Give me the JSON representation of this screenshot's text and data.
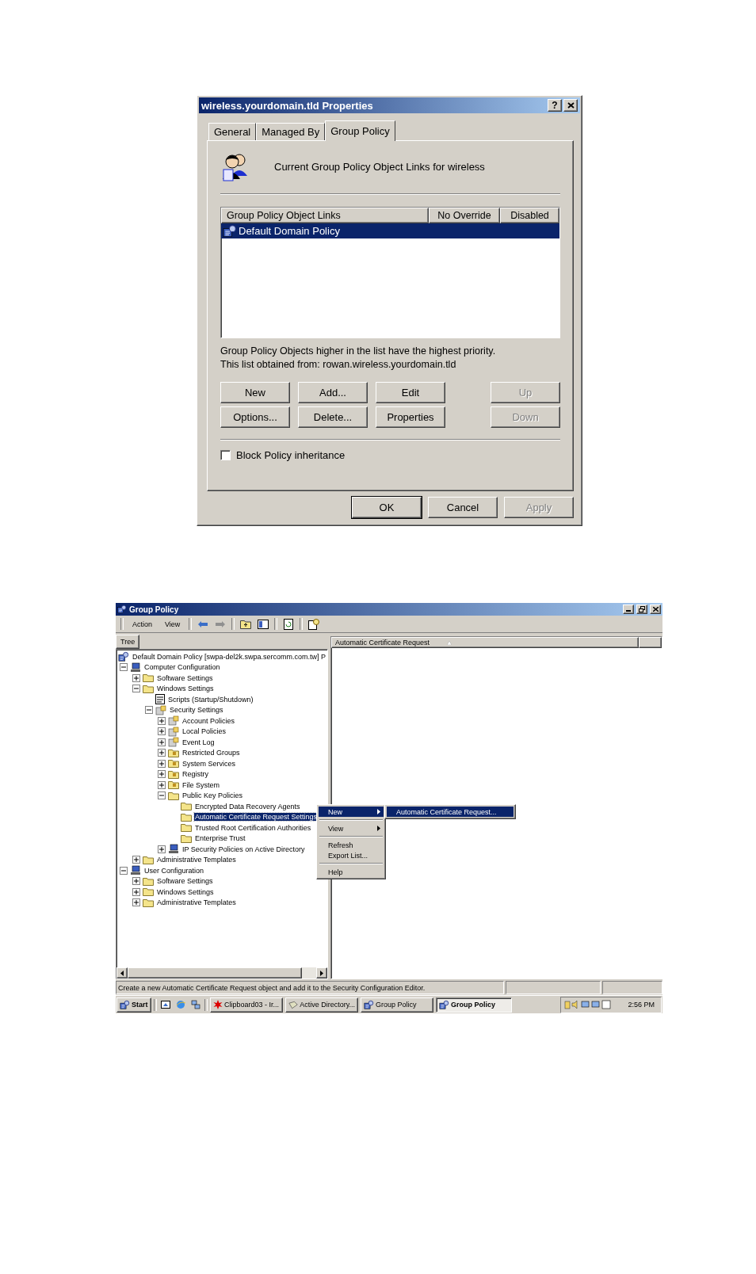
{
  "properties_dialog": {
    "title": "wireless.yourdomain.tld Properties",
    "help_button": "?",
    "tabs": [
      {
        "label": "General",
        "selected": false
      },
      {
        "label": "Managed By",
        "selected": false
      },
      {
        "label": "Group Policy",
        "selected": true
      }
    ],
    "header_text": "Current Group Policy Object Links for wireless",
    "list": {
      "columns": [
        "Group Policy Object Links",
        "No Override",
        "Disabled"
      ],
      "rows": [
        {
          "name": "Default Domain Policy",
          "selected": true
        }
      ]
    },
    "info_lines": [
      "Group Policy Objects higher in the list have the highest priority.",
      "This list obtained from: rowan.wireless.yourdomain.tld"
    ],
    "buttons": [
      {
        "label": "New",
        "disabled": false
      },
      {
        "label": "Add...",
        "disabled": false
      },
      {
        "label": "Edit",
        "disabled": false
      },
      {
        "label": "Up",
        "disabled": true
      },
      {
        "label": "Options...",
        "disabled": false
      },
      {
        "label": "Delete...",
        "disabled": false
      },
      {
        "label": "Properties",
        "disabled": false
      },
      {
        "label": "Down",
        "disabled": true
      }
    ],
    "block_inheritance": {
      "label": "Block Policy inheritance",
      "checked": false
    },
    "footer_buttons": [
      {
        "label": "OK",
        "disabled": false,
        "default": true
      },
      {
        "label": "Cancel",
        "disabled": false,
        "default": false
      },
      {
        "label": "Apply",
        "disabled": true,
        "default": false
      }
    ]
  },
  "group_policy_window": {
    "title": "Group Policy",
    "menu": [
      "Action",
      "View"
    ],
    "tree_tab": "Tree",
    "list_column": "Automatic Certificate Request",
    "tree": [
      {
        "label": "Default Domain Policy [swpa-del2k.swpa.sercomm.com.tw] P",
        "kind": "policy",
        "has_toggle": false,
        "selected": false,
        "children": [
          {
            "label": "Computer Configuration",
            "kind": "computer",
            "has_toggle": true,
            "expanded": true,
            "selected": false,
            "children": [
              {
                "label": "Software Settings",
                "kind": "folder",
                "has_toggle": true,
                "expanded": false,
                "selected": false
              },
              {
                "label": "Windows Settings",
                "kind": "folder",
                "has_toggle": true,
                "expanded": true,
                "selected": false,
                "children": [
                  {
                    "label": "Scripts (Startup/Shutdown)",
                    "kind": "scripts",
                    "has_toggle": false,
                    "selected": false
                  },
                  {
                    "label": "Security Settings",
                    "kind": "security",
                    "has_toggle": true,
                    "expanded": true,
                    "selected": false,
                    "children": [
                      {
                        "label": "Account Policies",
                        "kind": "security",
                        "has_toggle": true,
                        "expanded": false,
                        "selected": false
                      },
                      {
                        "label": "Local Policies",
                        "kind": "security",
                        "has_toggle": true,
                        "expanded": false,
                        "selected": false
                      },
                      {
                        "label": "Event Log",
                        "kind": "security",
                        "has_toggle": true,
                        "expanded": false,
                        "selected": false
                      },
                      {
                        "label": "Restricted Groups",
                        "kind": "lockfolder",
                        "has_toggle": true,
                        "expanded": false,
                        "selected": false
                      },
                      {
                        "label": "System Services",
                        "kind": "lockfolder",
                        "has_toggle": true,
                        "expanded": false,
                        "selected": false
                      },
                      {
                        "label": "Registry",
                        "kind": "lockfolder",
                        "has_toggle": true,
                        "expanded": false,
                        "selected": false
                      },
                      {
                        "label": "File System",
                        "kind": "lockfolder",
                        "has_toggle": true,
                        "expanded": false,
                        "selected": false
                      },
                      {
                        "label": "Public Key Policies",
                        "kind": "folder",
                        "has_toggle": true,
                        "expanded": true,
                        "selected": false,
                        "children": [
                          {
                            "label": "Encrypted Data Recovery Agents",
                            "kind": "folder",
                            "has_toggle": false,
                            "selected": false
                          },
                          {
                            "label": "Automatic Certificate Request Settings",
                            "kind": "folder",
                            "has_toggle": false,
                            "selected": true
                          },
                          {
                            "label": "Trusted Root Certification Authorities",
                            "kind": "folder",
                            "has_toggle": false,
                            "selected": false
                          },
                          {
                            "label": "Enterprise Trust",
                            "kind": "folder",
                            "has_toggle": false,
                            "selected": false
                          }
                        ]
                      },
                      {
                        "label": "IP Security Policies on Active Directory",
                        "kind": "computer",
                        "has_toggle": true,
                        "expanded": false,
                        "selected": false
                      }
                    ]
                  }
                ]
              },
              {
                "label": "Administrative Templates",
                "kind": "folder",
                "has_toggle": true,
                "expanded": false,
                "selected": false
              }
            ]
          },
          {
            "label": "User Configuration",
            "kind": "computer",
            "has_toggle": true,
            "expanded": true,
            "selected": false,
            "children": [
              {
                "label": "Software Settings",
                "kind": "folder",
                "has_toggle": true,
                "expanded": false,
                "selected": false
              },
              {
                "label": "Windows Settings",
                "kind": "folder",
                "has_toggle": true,
                "expanded": false,
                "selected": false
              },
              {
                "label": "Administrative Templates",
                "kind": "folder",
                "has_toggle": true,
                "expanded": false,
                "selected": false
              }
            ]
          }
        ]
      }
    ],
    "context_menu": {
      "groups": [
        {
          "items": [
            {
              "label": "New",
              "submenu": true,
              "selected": true
            }
          ]
        },
        {
          "items": [
            {
              "label": "View",
              "submenu": true,
              "selected": false
            }
          ]
        },
        {
          "items": [
            {
              "label": "Refresh",
              "submenu": false,
              "selected": false
            },
            {
              "label": "Export List...",
              "submenu": false,
              "selected": false
            }
          ]
        },
        {
          "items": [
            {
              "label": "Help",
              "submenu": false,
              "selected": false
            }
          ]
        }
      ]
    },
    "submenu": [
      {
        "label": "Automatic Certificate Request...",
        "selected": true
      }
    ],
    "status_text": "Create a new Automatic Certificate Request object and add it to the Security Configuration Editor.",
    "taskbar": {
      "start": "Start",
      "tasks": [
        {
          "label": "Clipboard03 - Ir...",
          "kind": "paint",
          "selected": false
        },
        {
          "label": "Active Directory...",
          "kind": "directory",
          "selected": false
        },
        {
          "label": "Group Policy",
          "kind": "policy",
          "selected": false
        },
        {
          "label": "Group Policy",
          "kind": "policy",
          "selected": true
        }
      ],
      "clock": "2:56 PM"
    }
  }
}
